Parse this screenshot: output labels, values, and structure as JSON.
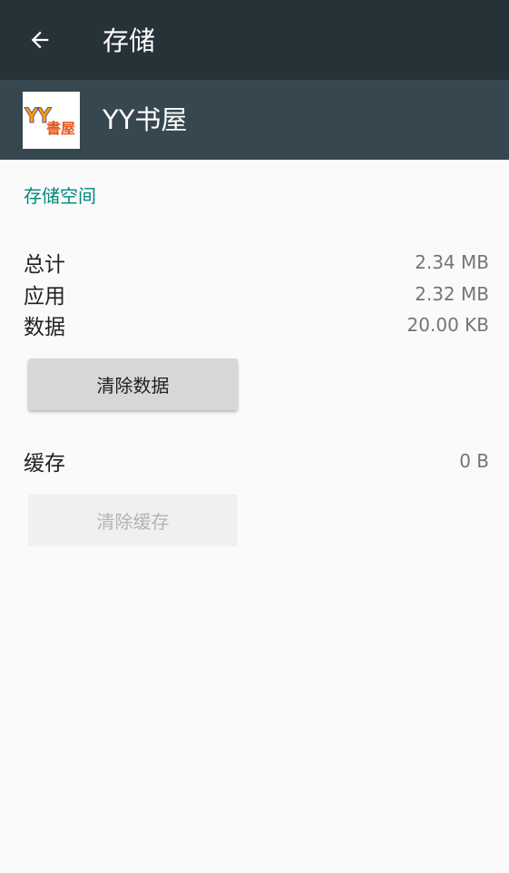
{
  "toolbar": {
    "title": "存储",
    "back_icon": "arrow-back-icon"
  },
  "app": {
    "name": "YY书屋",
    "icon_text_latin": "YY",
    "icon_text_cjk": "書屋"
  },
  "storage": {
    "section_title": "存储空间",
    "rows": [
      {
        "label": "总计",
        "value": "2.34 MB"
      },
      {
        "label": "应用",
        "value": "2.32 MB"
      },
      {
        "label": "数据",
        "value": "20.00 KB"
      }
    ],
    "clear_data_label": "清除数据",
    "cache_label": "缓存",
    "cache_value": "0 B",
    "clear_cache_label": "清除缓存"
  },
  "colors": {
    "toolbar_bg": "#263238",
    "app_header_bg": "#37474f",
    "accent": "#00897b",
    "page_bg": "#fafafa"
  }
}
